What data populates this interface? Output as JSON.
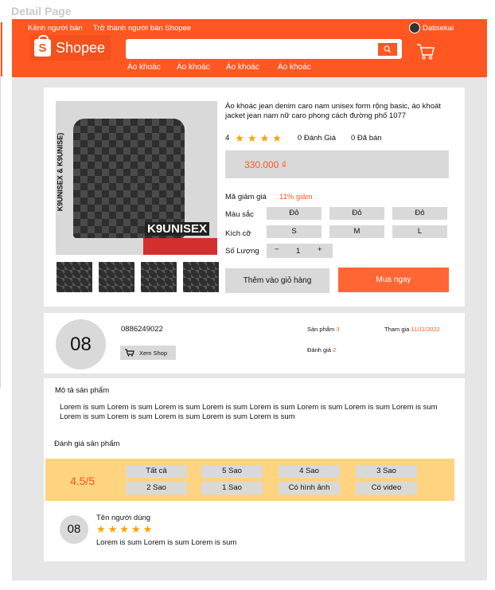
{
  "page_label": "Detail Page",
  "header": {
    "seller_channel": "Kênh người bán",
    "become_seller": "Trở thành người bán Shopee",
    "username": "Datisekai",
    "logo_text": "Shopee",
    "logo_mark": "S",
    "search_placeholder": "",
    "quick_links": [
      "Áo khoác",
      "Áo khoác",
      "Áo khoác",
      "Áo khoác"
    ],
    "brand_color": "#ff5722"
  },
  "product": {
    "image_side_text": "K9UNISEX & K9UNISE)",
    "image_brand": "K9UNISEX",
    "title": "Áo khoác jean denim caro nam unisex form rộng basic, áo khoát jacket jean nam nữ caro phong cách đường phố 1077",
    "rating": "4",
    "star_count": 4,
    "reviews": "0 Đánh Giá",
    "sold": "0 Đã bán",
    "price": "330.000 ₫",
    "discount_label": "Mã giảm giá",
    "discount_value": "11% giảm",
    "color_label": "Màu sắc",
    "colors": [
      "Đỏ",
      "Đỏ",
      "Đỏ"
    ],
    "size_label": "Kích cỡ",
    "sizes": [
      "S",
      "M",
      "L"
    ],
    "qty_label": "Số Lượng",
    "qty_minus": "−",
    "qty_value": "1",
    "qty_plus": "+",
    "add_to_cart": "Thêm vào giỏ hàng",
    "buy_now": "Mua ngay"
  },
  "shop": {
    "avatar_text": "08",
    "phone": "0886249022",
    "view_shop": "Xem Shop",
    "products_label": "Sản phẩm",
    "products_value": "3",
    "joined_label": "Tham gia",
    "joined_value": "11/11/2022",
    "rating_label": "Đánh giá",
    "rating_value": "2"
  },
  "description": {
    "title": "Mô tả sản phẩm",
    "text": "Lorem is sum Lorem is sum Lorem is sum Lorem is sum Lorem is sum Lorem is sum Lorem is sum Lorem is sum Lorem is sum Lorem is sum Lorem is sum Lorem is sum Lorem is sum"
  },
  "reviews": {
    "title": "Đánh giá sản phẩm",
    "score": "4.5/5",
    "filters": [
      "Tất cả",
      "5 Sao",
      "4 Sao",
      "3 Sao",
      "2 Sao",
      "1 Sao",
      "Có hình ảnh",
      "Có video"
    ],
    "items": [
      {
        "avatar_text": "08",
        "name": "Tên người dùng",
        "stars": 5,
        "text": "Lorem is sum Lorem is sum Lorem is sum"
      }
    ]
  }
}
